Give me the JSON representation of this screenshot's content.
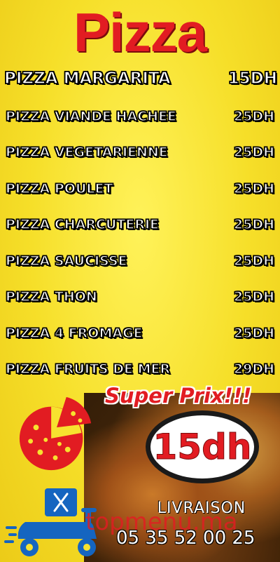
{
  "header": {
    "title": "Pizza"
  },
  "featured": {
    "name": "PIZZA MARGARITA",
    "price": "15DH"
  },
  "menu": [
    {
      "name": "PIZZA VIANDE HACHEE",
      "price": "25DH"
    },
    {
      "name": "PIZZA VEGETARIENNE",
      "price": "25DH"
    },
    {
      "name": "PIZZA POULET",
      "price": "25DH"
    },
    {
      "name": "PIZZA CHARCUTERIE",
      "price": "25DH"
    },
    {
      "name": "PIZZA SAUCISSE",
      "price": "25DH"
    },
    {
      "name": "PIZZA THON",
      "price": "25DH"
    },
    {
      "name": "PIZZA 4 FROMAGE",
      "price": "25DH"
    },
    {
      "name": "PIZZA FRUITS DE MER",
      "price": "29DH"
    }
  ],
  "promo": {
    "label": "Super Prix!!!",
    "price": "15dh"
  },
  "delivery": {
    "label": "LIVRAISON",
    "phone": "05 35 52 00 25"
  },
  "watermark": "topmenu.ma",
  "colors": {
    "background": "#f7e22f",
    "accent": "#e21c22",
    "scooter": "#1565c0"
  },
  "icons": {
    "pizza": "pizza-icon",
    "scooter": "delivery-scooter-icon",
    "utensils": "fork-knife-icon"
  }
}
